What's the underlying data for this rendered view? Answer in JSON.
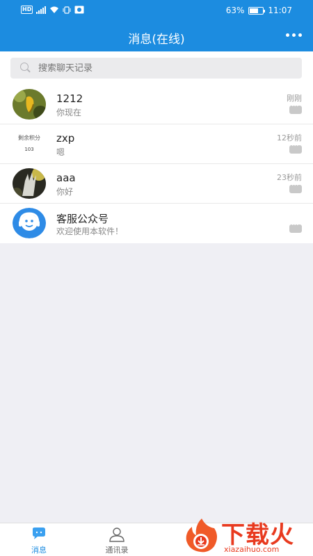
{
  "statusbar": {
    "battery_percent": "63%",
    "time": "11:07",
    "network_badge": "HD"
  },
  "header": {
    "title": "消息(在线)",
    "menu_icon": "more-dots-icon"
  },
  "search": {
    "placeholder": "搜索聊天记录",
    "icon": "search-icon"
  },
  "conversations": [
    {
      "name": "1212",
      "last_message": "你现在",
      "time": "刚刚",
      "avatar": "photo-avatar"
    },
    {
      "name": "zxp",
      "last_message": "嗯",
      "time": "12秒前",
      "avatar": "points-card-avatar",
      "avatar_text": "剩余积分",
      "avatar_number": "103"
    },
    {
      "name": "aaa",
      "last_message": "你好",
      "time": "23秒前",
      "avatar": "photo-avatar"
    },
    {
      "name": "客服公众号",
      "last_message": "欢迎使用本软件！",
      "time": "",
      "avatar": "customer-service-icon"
    }
  ],
  "tabbar": {
    "tabs": [
      {
        "label": "消息",
        "icon": "chat-bubble-icon",
        "active": true
      },
      {
        "label": "通讯录",
        "icon": "person-icon",
        "active": false
      }
    ]
  },
  "watermark": {
    "text_cn": "下载火",
    "text_en": "xiazaihuo.com"
  },
  "colors": {
    "primary": "#1c8ce0",
    "background": "#efeff4",
    "watermark": "#e83a1f"
  }
}
